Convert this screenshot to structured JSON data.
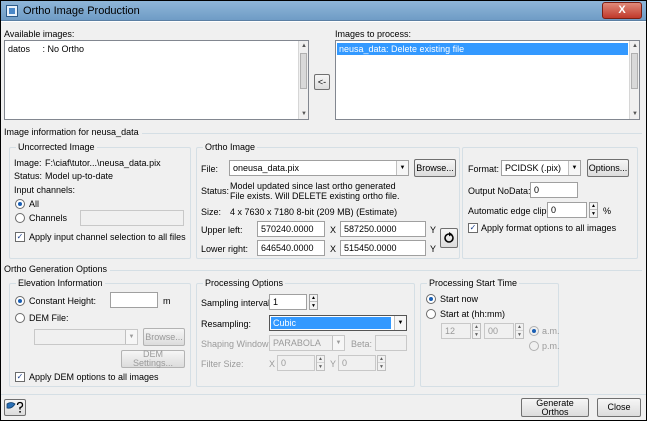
{
  "window": {
    "title": "Ortho Image Production",
    "close_label": "X"
  },
  "available": {
    "label": "Available images:",
    "items": [
      {
        "name": "datos",
        "status": ": No Ortho"
      }
    ]
  },
  "move_left_label": "<-",
  "process": {
    "label": "Images to process:",
    "items": [
      {
        "text": "neusa_data: Delete existing file"
      }
    ]
  },
  "image_info": {
    "title": "Image information for neusa_data",
    "uncorrected": {
      "title": "Uncorrected Image",
      "image_label": "Image:",
      "image_value": "F:\\ciaf\\tutor...\\neusa_data.pix",
      "status_label": "Status:",
      "status_value": "Model up-to-date",
      "channels_label": "Input channels:",
      "all_label": "All",
      "channels_opt_label": "Channels",
      "channels_value": "",
      "apply_label": "Apply input channel selection to all files"
    },
    "ortho": {
      "title": "Ortho Image",
      "file_label": "File:",
      "file_value": "oneusa_data.pix",
      "browse_label": "Browse...",
      "status_label": "Status:",
      "status_line1": "Model updated since last ortho generated",
      "status_line2": "File exists. Will DELETE existing ortho file.",
      "size_label": "Size:",
      "size_value": "4 x 7630 x 7180 8-bit (209 MB) (Estimate)",
      "upper_left_label": "Upper left:",
      "ul_x": "570240.0000",
      "ul_y": "587250.0000",
      "lower_right_label": "Lower right:",
      "lr_x": "646540.0000",
      "lr_y": "515450.0000",
      "x_label": "X",
      "y_label": "Y"
    },
    "format": {
      "format_label": "Format:",
      "format_value": "PCIDSK (.pix)",
      "options_label": "Options...",
      "nodata_label": "Output NoData:",
      "nodata_value": "0",
      "clip_label": "Automatic edge clip:",
      "clip_value": "0",
      "clip_unit": "%",
      "apply_label": "Apply format options to all images"
    }
  },
  "generation": {
    "title": "Ortho Generation Options",
    "elevation": {
      "title": "Elevation Information",
      "constant_label": "Constant Height:",
      "constant_value": "",
      "unit": "m",
      "dem_label": "DEM File:",
      "dem_value": "",
      "browse_label": "Browse...",
      "dem_settings_label": "DEM Settings...",
      "apply_label": "Apply DEM options to all images"
    },
    "processing": {
      "title": "Processing Options",
      "sampling_label": "Sampling interval:",
      "sampling_value": "1",
      "resampling_label": "Resampling:",
      "resampling_value": "Cubic",
      "shaping_label": "Shaping Window:",
      "shaping_value": "PARABOLA",
      "beta_label": "Beta:",
      "beta_value": "",
      "filter_label": "Filter Size:",
      "x_label": "X",
      "x_value": "0",
      "y_label": "Y",
      "y_value": "0"
    },
    "start": {
      "title": "Processing Start Time",
      "now_label": "Start now",
      "at_label": "Start at (hh:mm)",
      "hour": "12",
      "minute": "00",
      "am_label": "a.m.",
      "pm_label": "p.m."
    }
  },
  "footer": {
    "generate_label": "Generate Orthos",
    "close_label": "Close"
  }
}
